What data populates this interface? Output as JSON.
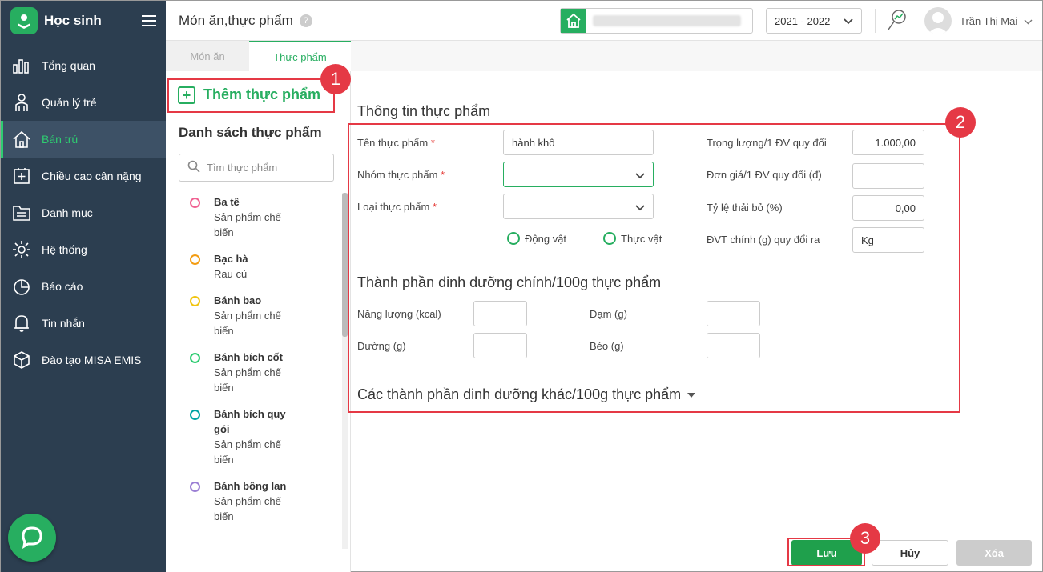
{
  "sidebar": {
    "brand": "Học sinh",
    "items": [
      {
        "label": "Tổng quan",
        "icon": "bar-chart-icon"
      },
      {
        "label": "Quản lý trẻ",
        "icon": "child-icon"
      },
      {
        "label": "Bán trú",
        "icon": "house-icon",
        "active": true
      },
      {
        "label": "Chiều cao cân nặng",
        "icon": "plus-square-icon"
      },
      {
        "label": "Danh mục",
        "icon": "folder-icon"
      },
      {
        "label": "Hệ thống",
        "icon": "gear-icon"
      },
      {
        "label": "Báo cáo",
        "icon": "pie-chart-icon"
      },
      {
        "label": "Tin nhắn",
        "icon": "bell-icon"
      },
      {
        "label": "Đào tạo MISA EMIS",
        "icon": "cube-icon"
      }
    ]
  },
  "header": {
    "title": "Món ăn,thực phẩm",
    "help": "?",
    "year": "2021 - 2022",
    "user_name": "Trần Thị Mai"
  },
  "tabs": [
    "Món ăn",
    "Thực phẩm"
  ],
  "left": {
    "add_label": "Thêm thực phẩm",
    "list_title": "Danh sách thực phẩm",
    "search_placeholder": "Tìm thực phẩm",
    "foods": [
      {
        "name": "Ba tê",
        "category": "Sản phẩm chế biến",
        "color": "#f06292"
      },
      {
        "name": "Bạc hà",
        "category": "Rau củ",
        "color": "#f39c12"
      },
      {
        "name": "Bánh bao",
        "category": "Sản phẩm chế biến",
        "color": "#f1c40f"
      },
      {
        "name": "Bánh bích cốt",
        "category": "Sản phẩm chế biến",
        "color": "#2ecc71"
      },
      {
        "name": "Bánh bích quy gói",
        "category": "Sản phẩm chế biến",
        "color": "#00a3a3"
      },
      {
        "name": "Bánh bông lan",
        "category": "Sản phẩm chế biến",
        "color": "#9b7fd4"
      }
    ]
  },
  "form": {
    "section_title": "Thông tin thực phẩm",
    "name_label": "Tên thực phẩm",
    "name_value": "hành khô",
    "group_label": "Nhóm thực phẩm",
    "type_label": "Loại thực phẩm",
    "radio_animal": "Động vật",
    "radio_plant": "Thực vật",
    "weight_label": "Trọng lượng/1 ĐV quy đổi",
    "weight_value": "1.000,00",
    "price_label": "Đơn giá/1 ĐV quy đổi (đ)",
    "price_value": "",
    "waste_label": "Tỷ lệ thải bỏ (%)",
    "waste_value": "0,00",
    "unit_label": "ĐVT chính (g) quy đổi ra",
    "unit_value": "Kg",
    "nutrition_title": "Thành phần dinh dưỡng chính/100g thực phẩm",
    "energy_label": "Năng lượng (kcal)",
    "protein_label": "Đạm (g)",
    "sugar_label": "Đường (g)",
    "fat_label": "Béo (g)",
    "other_title": "Các thành phần dinh dưỡng khác/100g thực phẩm"
  },
  "buttons": {
    "save": "Lưu",
    "cancel": "Hủy",
    "delete": "Xóa"
  },
  "annotations": [
    "1",
    "2",
    "3"
  ],
  "colors": {
    "accent": "#27ae60",
    "sidebar": "#2c3e50",
    "annotation": "#e53945"
  }
}
